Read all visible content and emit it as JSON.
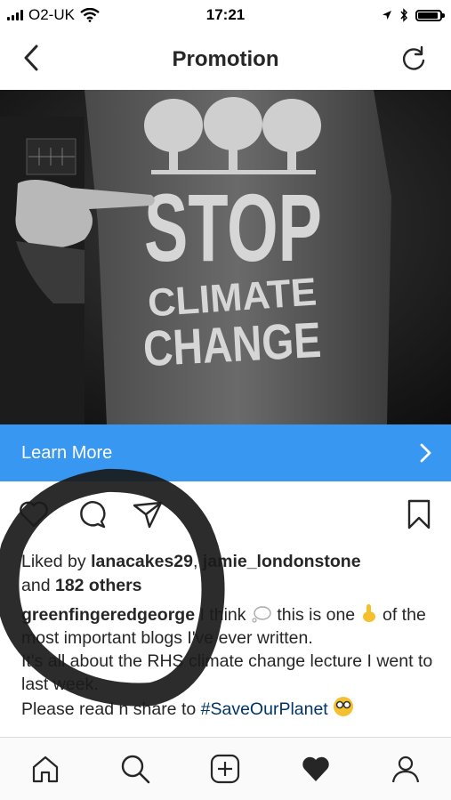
{
  "status_bar": {
    "carrier": "O2-UK",
    "time": "17:21",
    "battery_level": 0.9
  },
  "nav": {
    "title": "Promotion",
    "back_icon": "chevron-left-icon",
    "refresh_icon": "refresh-icon"
  },
  "post": {
    "image": {
      "shirt_text_line1": "STOP",
      "shirt_text_line2": "CLIMATE",
      "shirt_text_line3": "CHANGE"
    },
    "cta": {
      "label": "Learn More",
      "icon": "chevron-right-icon",
      "color": "#3897f0"
    },
    "actions": {
      "like_icon": "heart-outline-icon",
      "comment_icon": "comment-icon",
      "share_icon": "direct-share-icon",
      "save_icon": "bookmark-icon"
    },
    "likes": {
      "prefix": "Liked by",
      "user1": "lanacakes29",
      "separator": ",",
      "user2": "jamie_londonstone",
      "and": "and",
      "others": "182 others"
    },
    "caption": {
      "username": "greenfingeredgeorge",
      "text1": "I think",
      "text2": "this is one",
      "text3": "of the most important blogs I've ever written.",
      "text4": "It's all about the RHS climate change lecture I went to last week.",
      "text5": "Please read n share to",
      "hashtag": "#SaveOurPlanet"
    }
  },
  "tab_bar": {
    "items": [
      "home-icon",
      "search-icon",
      "add-post-icon",
      "activity-heart-icon",
      "profile-icon"
    ]
  }
}
